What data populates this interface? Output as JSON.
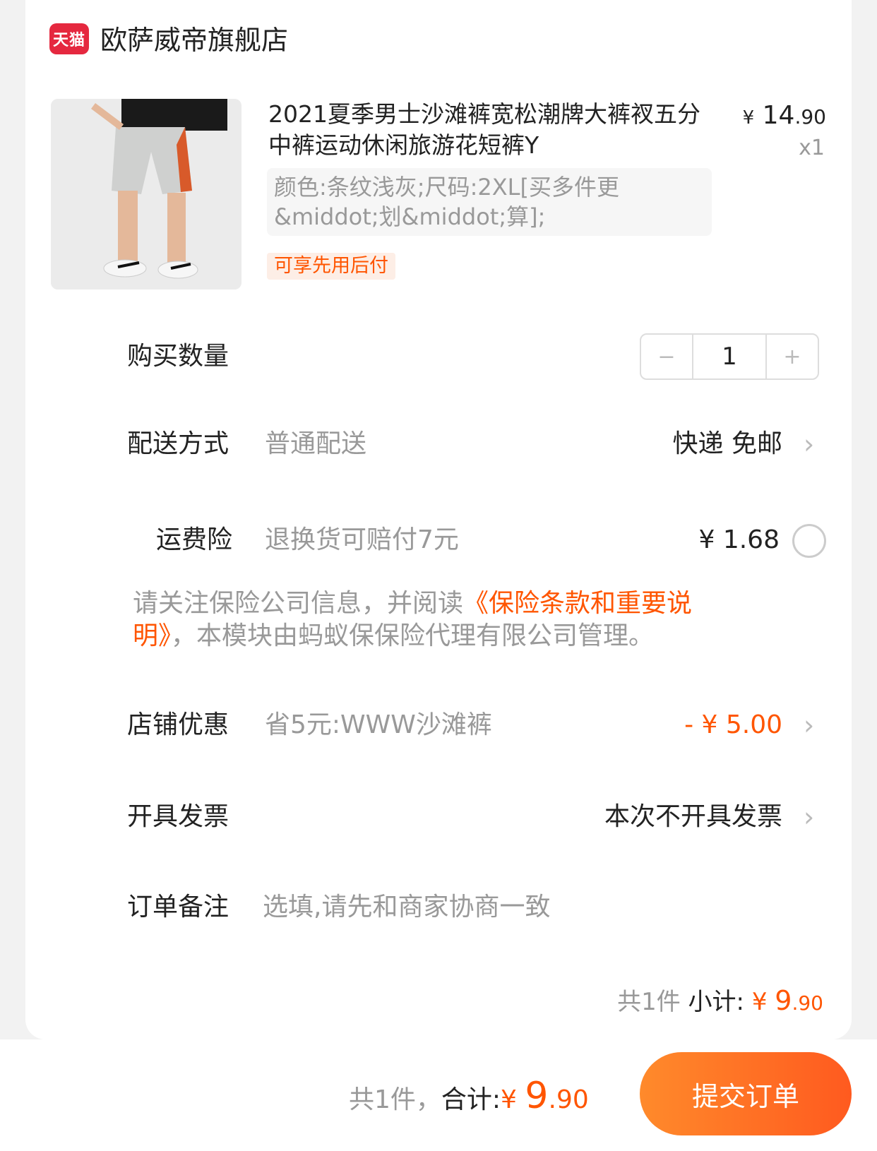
{
  "shop": {
    "logo_text": "天猫",
    "name": "欧萨威帝旗舰店"
  },
  "product": {
    "title": "2021夏季男士沙滩裤宽松潮牌大裤衩五分中裤运动休闲旅游花短裤Y",
    "price_currency": "¥",
    "price_int": "14",
    "price_dec": ".90",
    "quantity_mult": "x1",
    "sku": "颜色:条纹浅灰;尺码:2XL[买多件更&middot;划&middot;算];",
    "tag": "可享先用后付"
  },
  "quantity": {
    "label": "购买数量",
    "minus": "−",
    "value": "1",
    "plus": "+"
  },
  "delivery": {
    "label": "配送方式",
    "sub": "普通配送",
    "value": "快递 免邮"
  },
  "insurance": {
    "label": "运费险",
    "sub": "退换货可赔付7元",
    "value": "¥ 1.68"
  },
  "notice": {
    "pre": "请关注保险公司信息，并阅读",
    "link": "《保险条款和重要说明》",
    "post": "，本模块由蚂蚁保保险代理有限公司管理。"
  },
  "shop_discount": {
    "label": "店铺优惠",
    "sub": "省5元:WWW沙滩裤",
    "value": "- ¥ 5.00"
  },
  "invoice": {
    "label": "开具发票",
    "value": "本次不开具发票"
  },
  "remark": {
    "label": "订单备注",
    "placeholder": "选填,请先和商家协商一致"
  },
  "subtotal": {
    "count": "共1件",
    "label": "小计:",
    "currency": "¥ ",
    "int": "9",
    "dec": ".90"
  },
  "footer": {
    "count": "共1件，",
    "label": "合计:",
    "currency": "¥ ",
    "int": "9",
    "dec": ".90",
    "submit": "提交订单"
  },
  "icons": {
    "chevron": "chevron-right-icon",
    "radio": "radio-unchecked-icon"
  },
  "colors": {
    "accent": "#ff5500",
    "brand_tmall": "#e5283f",
    "button_start": "#ff8a2b",
    "button_end": "#ff5a1f"
  }
}
